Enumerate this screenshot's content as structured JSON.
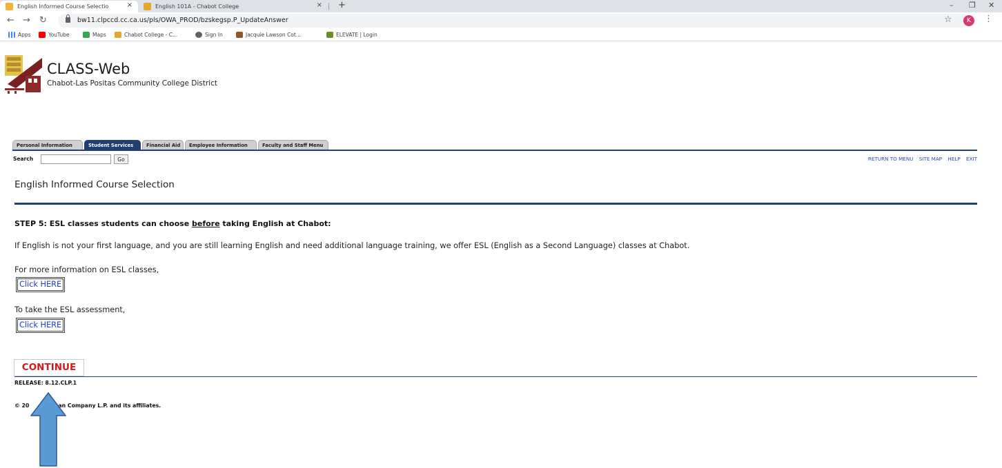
{
  "browser": {
    "tabs": [
      {
        "title": "English Informed Course Selectio",
        "active": true
      },
      {
        "title": "English 101A - Chabot College",
        "active": false
      }
    ],
    "new_tab": "+",
    "close_glyph": "×",
    "window_controls": {
      "minimize": "–",
      "maximize": "❐",
      "close": "✕"
    },
    "url": "bw11.clpccd.cc.ca.us/pls/OWA_PROD/bzskegsp.P_UpdateAnswer",
    "profile_initial": "K",
    "bookmarks": [
      "Apps",
      "YouTube",
      "Maps",
      "Chabot College - C...",
      "Sign In",
      "Jacquie Lawson Cot...",
      "ELEVATE | Login"
    ]
  },
  "site": {
    "title": "CLASS-Web",
    "subtitle": "Chabot-Las Positas Community College District"
  },
  "nav_tabs": [
    {
      "label": "Personal Information",
      "active": false
    },
    {
      "label": "Student Services",
      "active": true
    },
    {
      "label": "Financial Aid",
      "active": false
    },
    {
      "label": "Employee Information",
      "active": false
    },
    {
      "label": "Faculty and Staff Menu",
      "active": false
    }
  ],
  "search": {
    "label": "Search",
    "value": "",
    "go": "Go"
  },
  "top_links": [
    "RETURN TO MENU",
    "SITE MAP",
    "HELP",
    "EXIT"
  ],
  "content": {
    "heading": "English Informed Course Selection",
    "step_prefix": "STEP 5: ESL classes students can choose ",
    "step_underlined": "before",
    "step_suffix": " taking English at Chabot:",
    "intro": "If English is not your first language, and you are still learning English and need additional language training, we offer ESL (English as a Second Language) classes at Chabot.",
    "info_text": "For more information on ESL classes,",
    "info_button": "Click HERE",
    "assess_text": "To take the ESL assessment,",
    "assess_button": "Click HERE",
    "continue": "CONTINUE"
  },
  "footer": {
    "release": "RELEASE: 8.12.CLP.1",
    "copyright_left": "© 20",
    "copyright_right": "an Company L.P. and its affiliates."
  },
  "colors": {
    "nav_blue": "#1f3f6e",
    "continue_red": "#d11a1a",
    "link_blue": "#1e3ad6",
    "arrow_fill": "#5b9bd5",
    "arrow_stroke": "#2f5597"
  }
}
